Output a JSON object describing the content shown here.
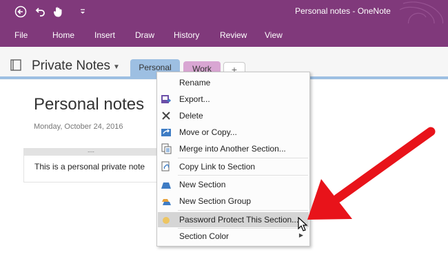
{
  "titlebar": {
    "title": "Personal notes  -  OneNote"
  },
  "ribbon": {
    "tabs": [
      {
        "id": "file",
        "label": "File"
      },
      {
        "id": "home",
        "label": "Home"
      },
      {
        "id": "insert",
        "label": "Insert"
      },
      {
        "id": "draw",
        "label": "Draw"
      },
      {
        "id": "history",
        "label": "History"
      },
      {
        "id": "review",
        "label": "Review"
      },
      {
        "id": "view",
        "label": "View"
      }
    ]
  },
  "notebook": {
    "name": "Private Notes",
    "sections": [
      {
        "label": "Personal",
        "color": "#9dbfe2"
      },
      {
        "label": "Work",
        "color": "#d9a6d3"
      }
    ],
    "add_label": "+"
  },
  "page": {
    "title": "Personal notes",
    "date": "Monday, October 24, 2016",
    "note_text": "This is a personal private note"
  },
  "context_menu": {
    "items": [
      {
        "label": "Rename",
        "icon": "rename-icon"
      },
      {
        "label": "Export...",
        "icon": "export-icon"
      },
      {
        "label": "Delete",
        "icon": "delete-icon"
      },
      {
        "label": "Move or Copy...",
        "icon": "move-copy-icon"
      },
      {
        "label": "Merge into Another Section...",
        "icon": "merge-icon"
      },
      {
        "label": "Copy Link to Section",
        "icon": "link-icon"
      },
      {
        "label": "New Section",
        "icon": "new-section-icon"
      },
      {
        "label": "New Section Group",
        "icon": "new-section-group-icon"
      },
      {
        "label": "Password Protect This Section...",
        "icon": "lock-icon",
        "highlighted": true
      },
      {
        "label": "Section Color",
        "icon": "",
        "submenu": true
      }
    ]
  },
  "colors": {
    "accent": "#80397b",
    "arrow": "#e8131a",
    "personal_tab": "#9dbfe2",
    "work_tab": "#d9a6d3",
    "highlight": "#d5d5d5"
  }
}
